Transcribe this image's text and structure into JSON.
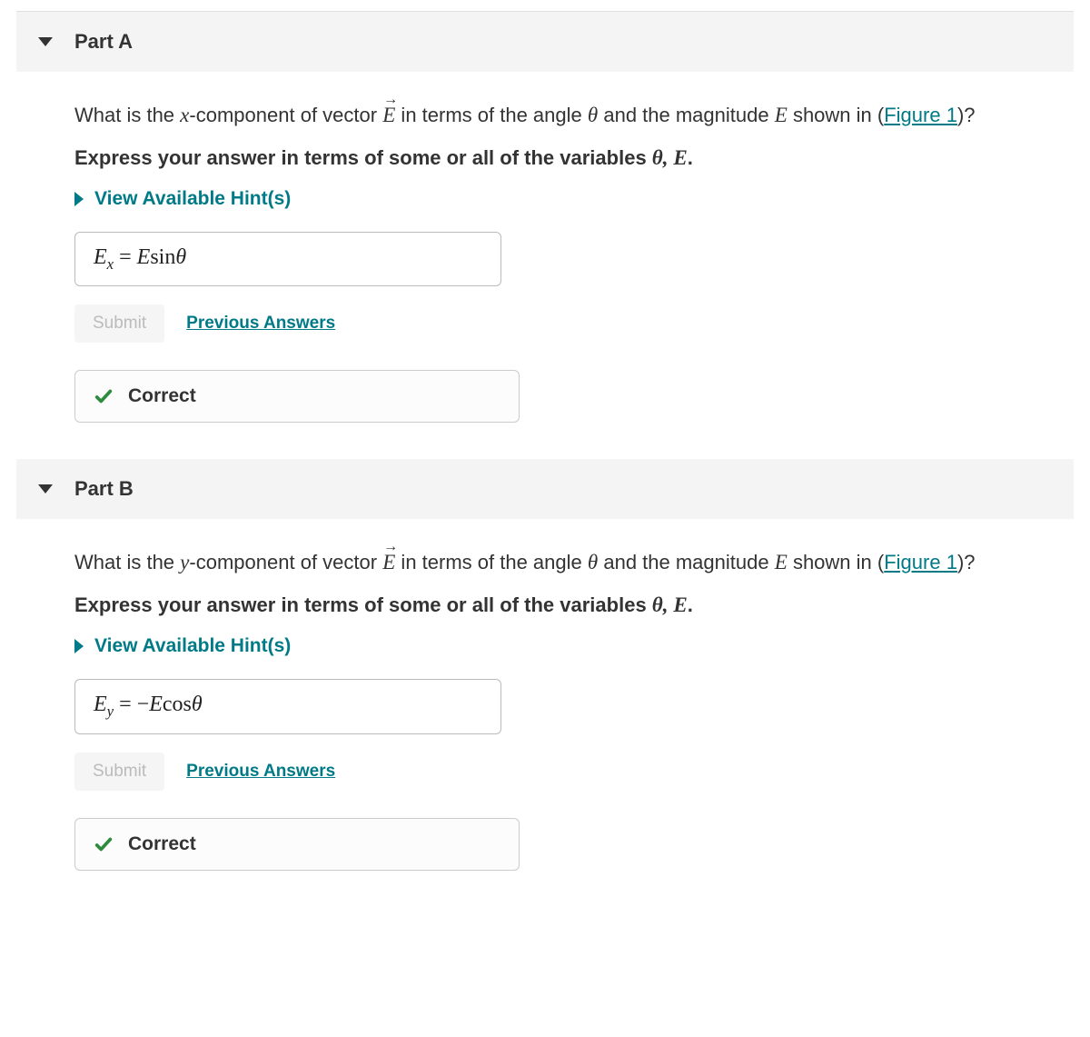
{
  "partA": {
    "title": "Part A",
    "question_prefix": "What is the ",
    "question_component": "x",
    "question_mid1": "-component of vector ",
    "question_vec": "E",
    "question_mid2": " in terms of the angle ",
    "question_theta": "θ",
    "question_mid3": " and the magnitude ",
    "question_mag": "E",
    "question_mid4": " shown in (",
    "figure_link": "Figure 1",
    "question_end": ")?",
    "instruction_prefix": "Express your answer in terms of some or all of the variables ",
    "instruction_vars": "θ, E",
    "instruction_end": ".",
    "hints_label": "View Available Hint(s)",
    "answer_lhs_var": "E",
    "answer_lhs_sub": "x",
    "answer_eq": " = ",
    "answer_rhs_pre": " ",
    "answer_rhs_E": "E",
    "answer_rhs_fn": "sin",
    "answer_rhs_arg": "θ",
    "submit_label": "Submit",
    "prev_label": "Previous Answers",
    "feedback": "Correct"
  },
  "partB": {
    "title": "Part B",
    "question_prefix": "What is the ",
    "question_component": "y",
    "question_mid1": "-component of vector ",
    "question_vec": "E",
    "question_mid2": " in terms of the angle ",
    "question_theta": "θ",
    "question_mid3": " and the magnitude ",
    "question_mag": "E",
    "question_mid4": " shown in (",
    "figure_link": "Figure 1",
    "question_end": ")?",
    "instruction_prefix": "Express your answer in terms of some or all of the variables ",
    "instruction_vars": "θ, E",
    "instruction_end": ".",
    "hints_label": "View Available Hint(s)",
    "answer_lhs_var": "E",
    "answer_lhs_sub": "y",
    "answer_eq": " = ",
    "answer_rhs_pre": " −",
    "answer_rhs_E": "E",
    "answer_rhs_fn": "cos",
    "answer_rhs_arg": "θ",
    "submit_label": "Submit",
    "prev_label": "Previous Answers",
    "feedback": "Correct"
  }
}
